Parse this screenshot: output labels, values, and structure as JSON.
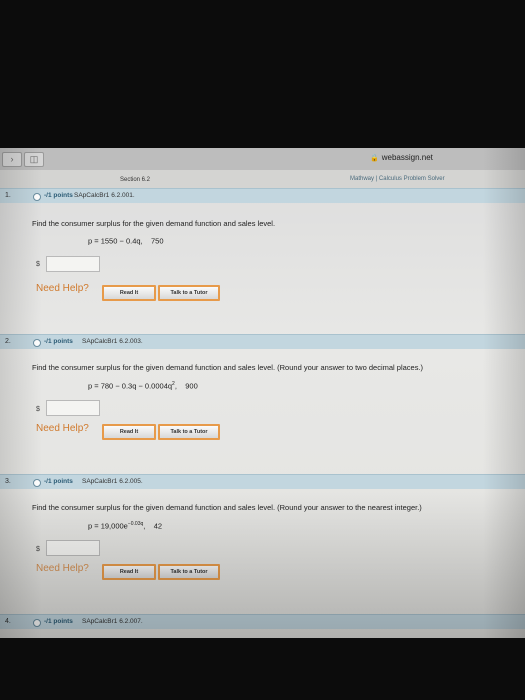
{
  "browser": {
    "url": "webassign.net"
  },
  "page": {
    "section_title": "Section 6.2",
    "mathway_link": "Mathway | Calculus Problem Solver"
  },
  "questions": [
    {
      "number": "1.",
      "points": "-/1 points",
      "code": "SApCalcBr1 6.2.001.",
      "text": "Find the consumer surplus for the given demand function and sales level.",
      "equation_lhs": "p = 1550 − 0.4q,",
      "equation_sup": "",
      "equation_rest": "",
      "sales_level": "750",
      "answer_prefix": "$",
      "answer_value": "",
      "need_help": "Need Help?",
      "read_it": "Read It",
      "talk_tutor": "Talk to a Tutor"
    },
    {
      "number": "2.",
      "points": "-/1 points",
      "code": "SApCalcBr1 6.2.003.",
      "text": "Find the consumer surplus for the given demand function and sales level. (Round your answer to two decimal places.)",
      "equation_lhs": "p = 780 − 0.3q − 0.0004q",
      "equation_sup": "2",
      "equation_rest": ",",
      "sales_level": "900",
      "answer_prefix": "$",
      "answer_value": "",
      "need_help": "Need Help?",
      "read_it": "Read It",
      "talk_tutor": "Talk to a Tutor"
    },
    {
      "number": "3.",
      "points": "-/1 points",
      "code": "SApCalcBr1 6.2.005.",
      "text": "Find the consumer surplus for the given demand function and sales level. (Round your answer to the nearest integer.)",
      "equation_lhs": "p = 19,000e",
      "equation_sup": "−0.03q",
      "equation_rest": ",",
      "sales_level": "42",
      "answer_prefix": "$",
      "answer_value": "",
      "need_help": "Need Help?",
      "read_it": "Read It",
      "talk_tutor": "Talk to a Tutor"
    },
    {
      "number": "4.",
      "points": "-/1 points",
      "code": "SApCalcBr1 6.2.007."
    }
  ]
}
